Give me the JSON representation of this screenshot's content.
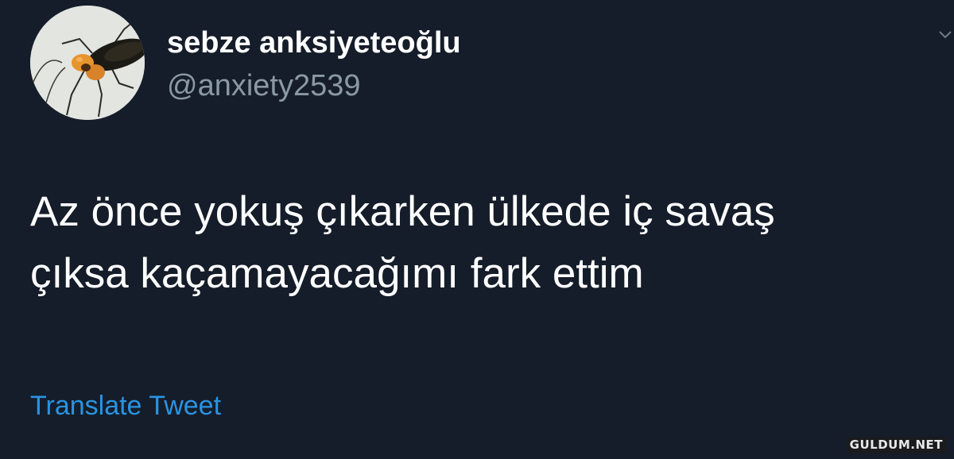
{
  "tweet": {
    "author": {
      "display_name": "sebze anksiyeteoğlu",
      "handle": "@anxiety2539",
      "avatar_icon": "cockroach-avatar"
    },
    "text_lines": [
      "Az önce yokuş çıkarken ülkede iç savaş",
      "çıksa kaçamayacağımı fark ettim"
    ],
    "translate_label": "Translate Tweet",
    "menu_icon": "chevron-down-icon"
  },
  "watermark": "GULDUM.NET",
  "colors": {
    "background": "#151d2a",
    "name": "#ffffff",
    "handle": "#8b98a5",
    "link": "#2a93e1"
  }
}
